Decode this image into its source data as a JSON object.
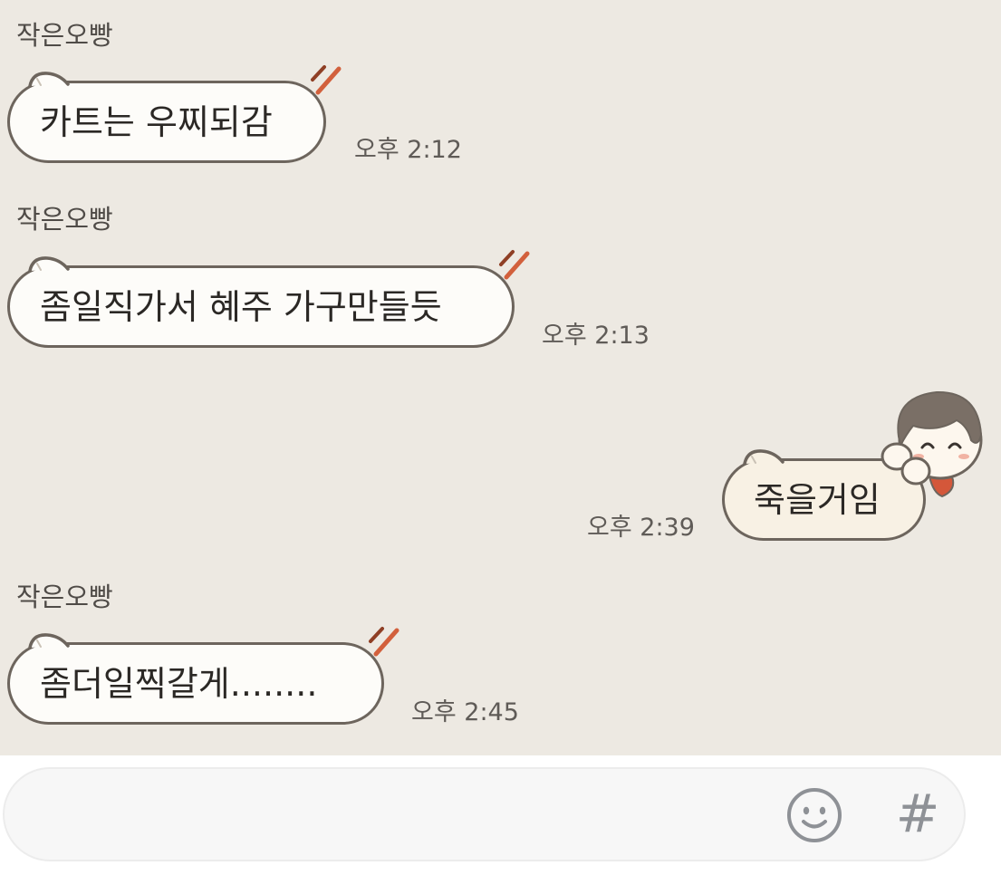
{
  "colors": {
    "chat_background": "#ede9e2",
    "bubble_border": "#6d655d",
    "bubble_received_fill": "#fdfcf9",
    "bubble_sent_fill": "#f8f1e4",
    "steam_accent": "#d2603c",
    "input_background": "#f7f7f7",
    "icon_gray": "#8e9196"
  },
  "messages": [
    {
      "direction": "received",
      "sender": "작은오빵",
      "text": "카트는 우찌되감",
      "time": "오후 2:12"
    },
    {
      "direction": "received",
      "sender": "작은오빵",
      "text": "좀일직가서 혜주 가구만들듯",
      "time": "오후 2:13"
    },
    {
      "direction": "sent",
      "text": "죽을거임",
      "time": "오후 2:39",
      "sticker_icon": "peeking-boy-character"
    },
    {
      "direction": "received",
      "sender": "작은오빵",
      "text": "좀더일찍갈게........",
      "time": "오후 2:45"
    }
  ],
  "input_bar": {
    "value": "",
    "emoji_icon": "smiley-face-icon",
    "hash_icon": "hash-icon",
    "hash_glyph": "#"
  }
}
